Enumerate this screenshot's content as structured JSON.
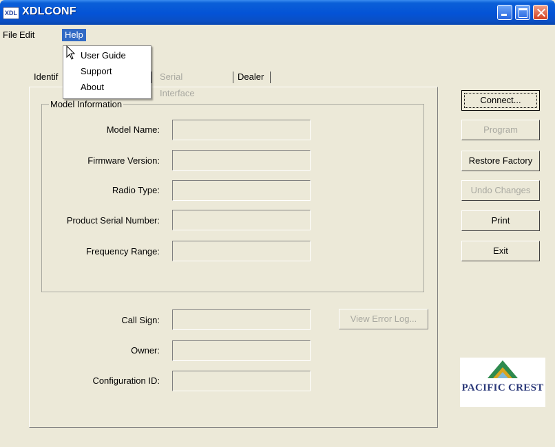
{
  "window": {
    "title": "XDLCONF",
    "icon_text": "XDL"
  },
  "menubar": {
    "items": [
      "File",
      "Edit",
      "Help"
    ]
  },
  "help_menu": {
    "items": [
      "User Guide",
      "Support",
      "About"
    ]
  },
  "tabs": {
    "items": [
      "Identif",
      "Serial Interface",
      "Dealer"
    ]
  },
  "model_info": {
    "legend": "Model Information",
    "labels": [
      "Model Name:",
      "Firmware Version:",
      "Radio Type:",
      "Product Serial Number:",
      "Frequency Range:"
    ]
  },
  "lower_fields": {
    "labels": [
      "Call Sign:",
      "Owner:",
      "Configuration ID:"
    ]
  },
  "buttons": {
    "connect": "Connect...",
    "program": "Program",
    "restore": "Restore Factory",
    "undo": "Undo Changes",
    "print": "Print",
    "exit": "Exit",
    "view_error_log": "View Error Log..."
  },
  "logo": {
    "text": "PACIFIC CREST"
  },
  "colors": {
    "titlebar": "#0453d6",
    "menu_highlight": "#316ac5",
    "window_bg": "#ece9d8",
    "logo_text": "#2c3a7a",
    "logo_green": "#2e8a4e",
    "logo_gold": "#d9a520"
  }
}
